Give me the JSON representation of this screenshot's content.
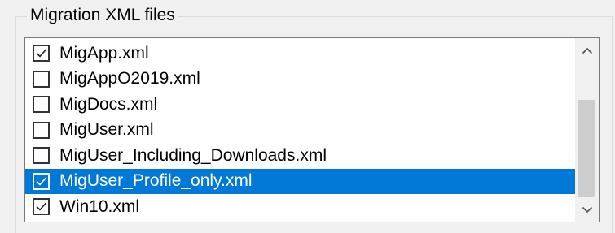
{
  "group": {
    "title": "Migration XML files"
  },
  "list": {
    "items": [
      {
        "label": "MigApp.xml",
        "checked": true,
        "selected": false
      },
      {
        "label": "MigAppO2019.xml",
        "checked": false,
        "selected": false
      },
      {
        "label": "MigDocs.xml",
        "checked": false,
        "selected": false
      },
      {
        "label": "MigUser.xml",
        "checked": false,
        "selected": false
      },
      {
        "label": "MigUser_Including_Downloads.xml",
        "checked": false,
        "selected": false
      },
      {
        "label": "MigUser_Profile_only.xml",
        "checked": true,
        "selected": true
      },
      {
        "label": "Win10.xml",
        "checked": true,
        "selected": false
      }
    ]
  },
  "scrollbar": {
    "up_icon": "chevron-up-icon",
    "down_icon": "chevron-down-icon"
  },
  "colors": {
    "selection": "#0078d7",
    "thumb": "#cdcdcd"
  }
}
